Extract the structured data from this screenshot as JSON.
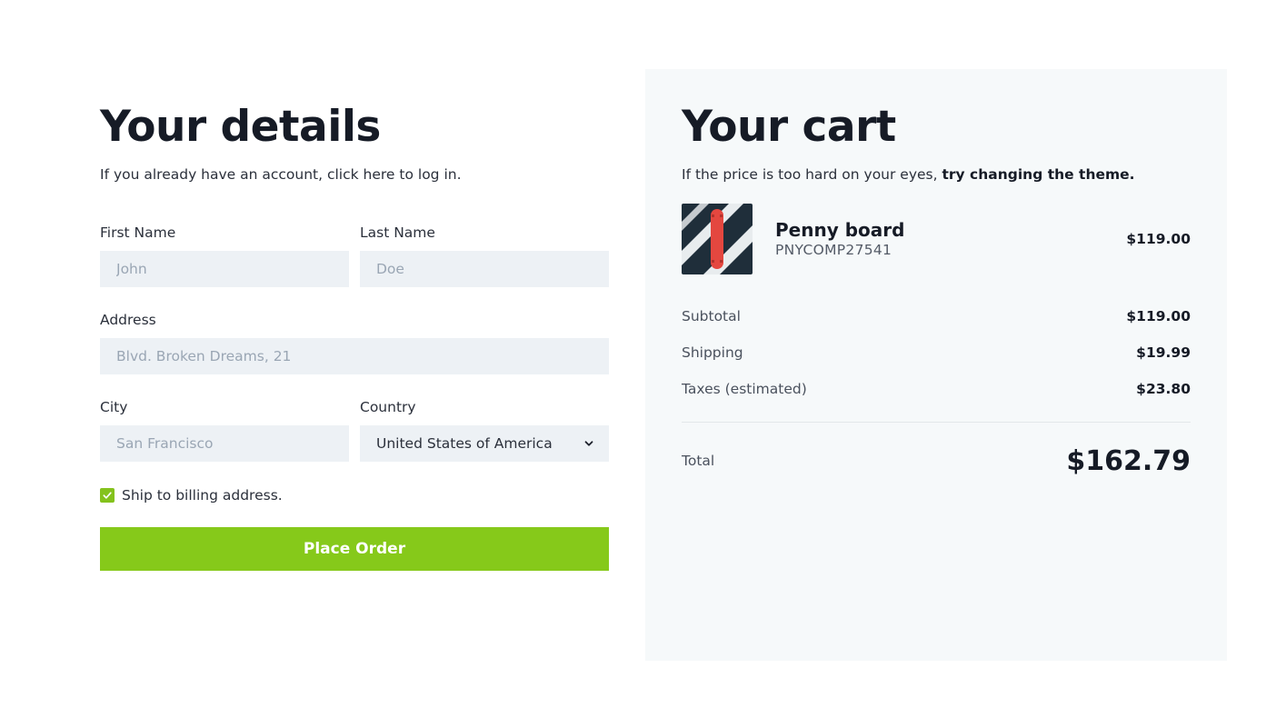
{
  "details": {
    "title": "Your details",
    "subtitle": "If you already have an account, click here to log in.",
    "first_name": {
      "label": "First Name",
      "placeholder": "John"
    },
    "last_name": {
      "label": "Last Name",
      "placeholder": "Doe"
    },
    "address": {
      "label": "Address",
      "placeholder": "Blvd. Broken Dreams, 21"
    },
    "city": {
      "label": "City",
      "placeholder": "San Francisco"
    },
    "country": {
      "label": "Country",
      "value": "United States of America"
    },
    "ship_checkbox": {
      "label": "Ship to billing address.",
      "checked": true
    },
    "place_order_label": "Place Order"
  },
  "cart": {
    "title": "Your cart",
    "subtitle_prefix": "If the price is too hard on your eyes, ",
    "subtitle_link": "try changing the theme.",
    "product": {
      "name": "Penny board",
      "sku": "PNYCOMP27541",
      "price": "$119.00"
    },
    "subtotal": {
      "label": "Subtotal",
      "value": "$119.00"
    },
    "shipping": {
      "label": "Shipping",
      "value": "$19.99"
    },
    "taxes": {
      "label": "Taxes (estimated)",
      "value": "$23.80"
    },
    "total": {
      "label": "Total",
      "value": "$162.79"
    }
  },
  "colors": {
    "accent": "#86c91a",
    "input_bg": "#edf1f5",
    "cart_bg": "#f6f9fa",
    "heading": "#161b26"
  },
  "icons": {
    "checkbox": "check-icon",
    "select": "chevron-down-icon"
  }
}
